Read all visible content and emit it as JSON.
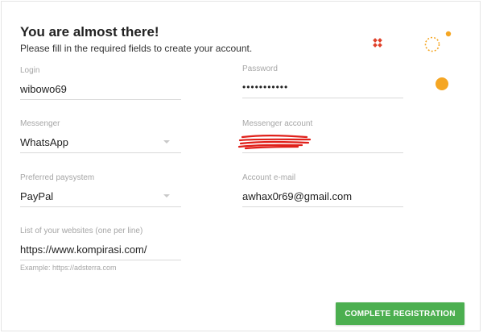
{
  "form": {
    "title": "You are almost there!",
    "subtitle": "Please fill in the required fields to create your account."
  },
  "fields": {
    "login": {
      "label": "Login",
      "value": "wibowo69"
    },
    "password": {
      "label": "Password",
      "value": "•••••••••••"
    },
    "messenger": {
      "label": "Messenger",
      "value": "WhatsApp"
    },
    "messenger_account": {
      "label": "Messenger account",
      "value": ""
    },
    "paysystem": {
      "label": "Preferred paysystem",
      "value": "PayPal"
    },
    "email": {
      "label": "Account e-mail",
      "value": "awhax0r69@gmail.com"
    },
    "websites": {
      "label": "List of your websites (one per line)",
      "value": "https://www.kompirasi.com/",
      "hint": "Example: https://adsterra.com"
    }
  },
  "actions": {
    "submit_label": "COMPLETE REGISTRATION"
  },
  "colors": {
    "button_green": "#4caf50",
    "decor_orange": "#f5a623",
    "decor_red": "#e0412a",
    "redaction_red": "#e0201a"
  }
}
